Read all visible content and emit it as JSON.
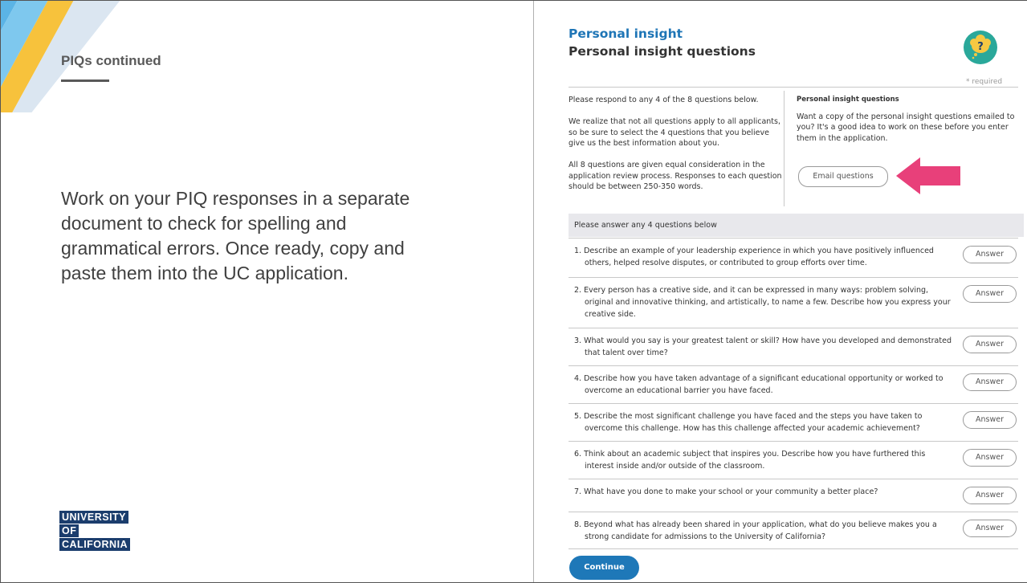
{
  "slide": {
    "title": "PIQs continued",
    "body": "Work on your PIQ responses in a separate document to check for spelling and grammatical errors. Once ready, copy and paste them into the UC application.",
    "logo_lines": [
      "UNIVERSITY",
      "OF",
      "CALIFORNIA"
    ]
  },
  "app": {
    "section_title": "Personal insight",
    "page_title": "Personal insight questions",
    "help_icon": "question-bubble-icon",
    "required_note": "* required",
    "intro_left": [
      "Please respond to any 4 of the 8 questions below.",
      "We realize that not all questions apply to all applicants, so be sure to select the 4 questions that you believe give us the best information about you.",
      "All 8 questions are given equal consideration in the application review process. Responses to each question should be between 250-350 words."
    ],
    "intro_right": {
      "subhead": "Personal insight questions",
      "text": "Want a copy of the personal insight questions emailed to you? It's a good idea to work on these before you enter them in the application.",
      "email_button": "Email questions"
    },
    "questions_header": "Please answer any 4 questions below",
    "answer_label": "Answer",
    "questions": [
      "1. Describe an example of your leadership experience in which you have positively influenced others, helped resolve disputes, or contributed to group efforts over time.",
      "2. Every person has a creative side, and it can be expressed in many ways: problem solving, original and innovative thinking, and artistically, to name a few. Describe how you express your creative side.",
      "3. What would you say is your greatest talent or skill? How have you developed and demonstrated that talent over time?",
      "4. Describe how you have taken advantage of a significant educational opportunity or worked to overcome an educational barrier you have faced.",
      "5. Describe the most significant challenge you have faced and the steps you have taken to overcome this challenge. How has this challenge affected your academic achievement?",
      "6. Think about an academic subject that inspires you. Describe how you have furthered this interest inside and/or outside of the classroom.",
      "7. What have you done to make your school or your community a better place?",
      "8. Beyond what has already been shared in your application, what do you believe makes you a strong candidate for admissions to the University of California?"
    ],
    "continue_button": "Continue"
  },
  "colors": {
    "accent_blue": "#1e75b6",
    "arrow_pink": "#e8407a",
    "logo_navy": "#1b3d6d",
    "help_teal": "#2aa89a"
  }
}
